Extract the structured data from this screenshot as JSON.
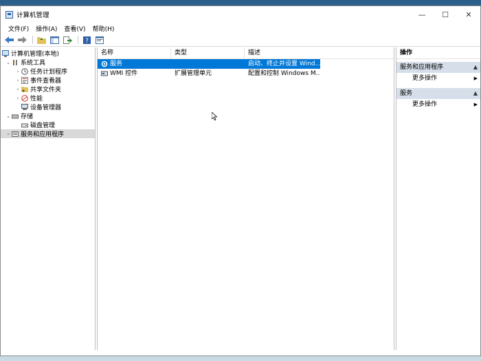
{
  "window": {
    "title": "计算机管理"
  },
  "menu": [
    "文件(F)",
    "操作(A)",
    "查看(V)",
    "帮助(H)"
  ],
  "toolbar": {
    "icons": [
      "back-arrow-icon",
      "forward-arrow-icon",
      "up-folder-icon",
      "show-hide-tree-icon",
      "export-list-icon",
      "help-icon",
      "properties-icon"
    ]
  },
  "tree": {
    "root": "计算机管理(本地)",
    "system_tools": "系统工具",
    "task_scheduler": "任务计划程序",
    "event_viewer": "事件查看器",
    "shared_folders": "共享文件夹",
    "performance": "性能",
    "device_manager": "设备管理器",
    "storage": "存储",
    "disk_management": "磁盘管理",
    "services_apps": "服务和应用程序"
  },
  "list": {
    "headers": {
      "name": "名称",
      "type": "类型",
      "desc": "描述"
    },
    "rows": [
      {
        "name": "服务",
        "type": "",
        "desc": "启动、终止并设置 Wind..."
      },
      {
        "name": "WMI 控件",
        "type": "扩展管理单元",
        "desc": "配置和控制 Windows M..."
      }
    ]
  },
  "actions": {
    "header": "操作",
    "section1": "服务和应用程序",
    "section1_more": "更多操作",
    "section2": "服务",
    "section2_more": "更多操作"
  },
  "colors": {
    "selection": "#0078d7",
    "section_bg": "#d5dee9"
  }
}
